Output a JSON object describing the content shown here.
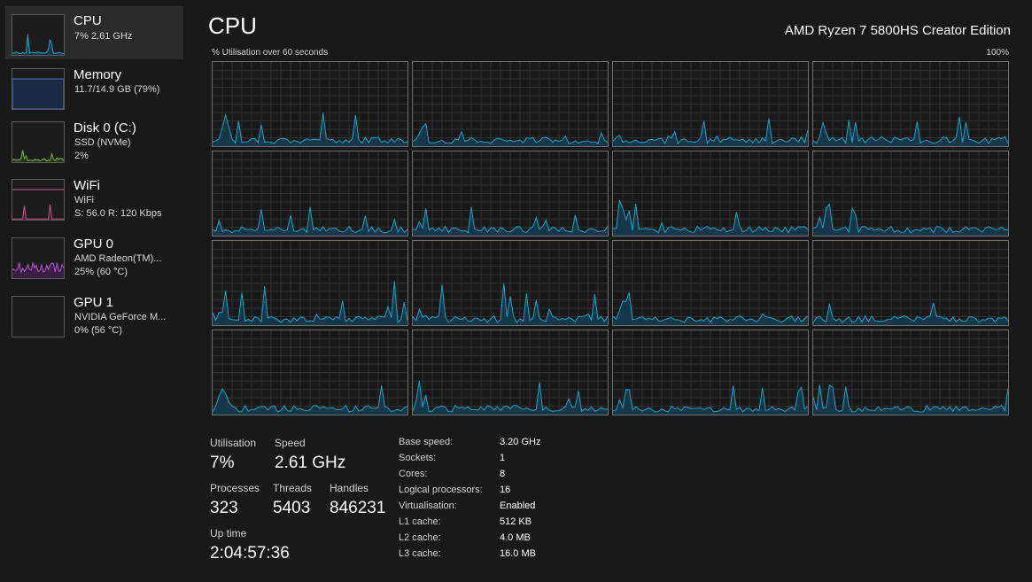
{
  "sidebar": {
    "items": [
      {
        "title": "CPU",
        "line1": "7% 2.61 GHz",
        "line2": "",
        "selected": true,
        "color": "#17a2c9",
        "icon": "cpu-graph-icon"
      },
      {
        "title": "Memory",
        "line1": "11.7/14.9 GB (79%)",
        "line2": "",
        "selected": false,
        "color": "#4a78c4",
        "icon": "memory-graph-icon"
      },
      {
        "title": "Disk 0 (C:)",
        "line1": "SSD (NVMe)",
        "line2": "2%",
        "selected": false,
        "color": "#7cb82f",
        "icon": "disk-graph-icon"
      },
      {
        "title": "WiFi",
        "line1": "WiFi",
        "line2": "S: 56.0  R: 120 Kbps",
        "selected": false,
        "color": "#c7548c",
        "icon": "wifi-graph-icon"
      },
      {
        "title": "GPU 0",
        "line1": "AMD Radeon(TM)...",
        "line2": "25%  (60 °C)",
        "selected": false,
        "color": "#b94fd0",
        "icon": "gpu0-graph-icon"
      },
      {
        "title": "GPU 1",
        "line1": "NVIDIA GeForce M...",
        "line2": "0%  (56 °C)",
        "selected": false,
        "color": "#b94fd0",
        "icon": "gpu1-graph-icon"
      }
    ]
  },
  "main": {
    "title": "CPU",
    "model": "AMD Ryzen 7 5800HS Creator Edition",
    "graph_caption": "% Utilisation over 60 seconds",
    "graph_max": "100%",
    "graph_color": "#17a2c9",
    "graph_fill": "#14384a"
  },
  "stats": {
    "utilisation_label": "Utilisation",
    "utilisation": "7%",
    "speed_label": "Speed",
    "speed": "2.61 GHz",
    "processes_label": "Processes",
    "processes": "323",
    "threads_label": "Threads",
    "threads": "5403",
    "handles_label": "Handles",
    "handles": "846231",
    "uptime_label": "Up time",
    "uptime": "2:04:57:36"
  },
  "info": [
    {
      "key": "Base speed:",
      "value": "3.20 GHz"
    },
    {
      "key": "Sockets:",
      "value": "1"
    },
    {
      "key": "Cores:",
      "value": "8"
    },
    {
      "key": "Logical processors:",
      "value": "16"
    },
    {
      "key": "Virtualisation:",
      "value": "Enabled"
    },
    {
      "key": "L1 cache:",
      "value": "512 KB"
    },
    {
      "key": "L2 cache:",
      "value": "4.0 MB"
    },
    {
      "key": "L3 cache:",
      "value": "16.0 MB"
    }
  ]
}
